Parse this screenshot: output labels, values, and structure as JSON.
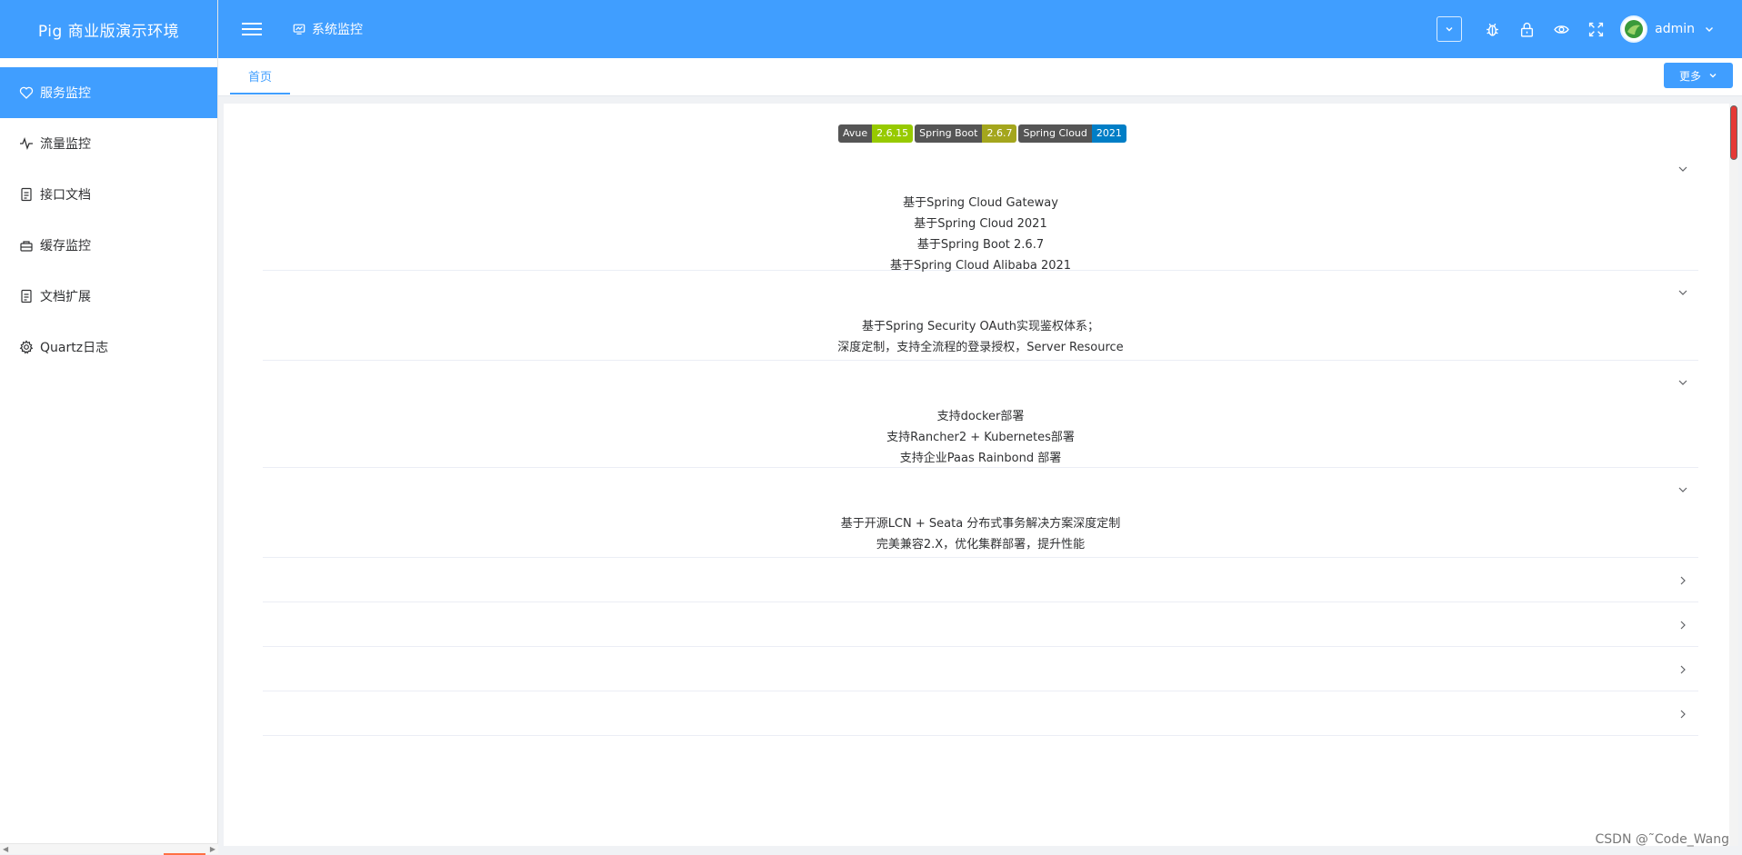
{
  "app": {
    "title": "Pig 商业版演示环境"
  },
  "sidebar": {
    "items": [
      {
        "label": "服务监控",
        "icon": "heart-icon",
        "active": true
      },
      {
        "label": "流量监控",
        "icon": "pulse-icon",
        "active": false
      },
      {
        "label": "接口文档",
        "icon": "document-icon",
        "active": false
      },
      {
        "label": "缓存监控",
        "icon": "database-icon",
        "active": false
      },
      {
        "label": "文档扩展",
        "icon": "document-icon",
        "active": false
      },
      {
        "label": "Quartz日志",
        "icon": "gear-icon",
        "active": false
      }
    ]
  },
  "header": {
    "breadcrumb": "系统监控",
    "username": "admin"
  },
  "tabs": {
    "home": "首页",
    "more": "更多"
  },
  "badges": [
    {
      "label": "Avue",
      "version": "2.6.15",
      "color": "#97ca00"
    },
    {
      "label": "Spring Boot",
      "version": "2.6.7",
      "color": "#a4a61d"
    },
    {
      "label": "Spring Cloud",
      "version": "2021",
      "color": "#007ec6"
    }
  ],
  "sections": [
    {
      "lines": [
        "基于Spring Cloud Gateway",
        "基于Spring Cloud 2021",
        "基于Spring Boot 2.6.7",
        "基于Spring Cloud Alibaba 2021"
      ]
    },
    {
      "lines": [
        "基于Spring Security OAuth实现鉴权体系；",
        "深度定制，支持全流程的登录授权，Server Resource"
      ]
    },
    {
      "lines": [
        "支持docker部署",
        "支持Rancher2 + Kubernetes部署",
        "支持企业Paas Rainbond 部署"
      ]
    },
    {
      "lines": [
        "基于开源LCN + Seata 分布式事务解决方案深度定制",
        "完美兼容2.X，优化集群部署，提升性能"
      ]
    }
  ],
  "collapsed_sections": 4,
  "watermark": "CSDN @˜Code_Wang",
  "colors": {
    "primary": "#409eff",
    "badge_label": "#555555"
  }
}
